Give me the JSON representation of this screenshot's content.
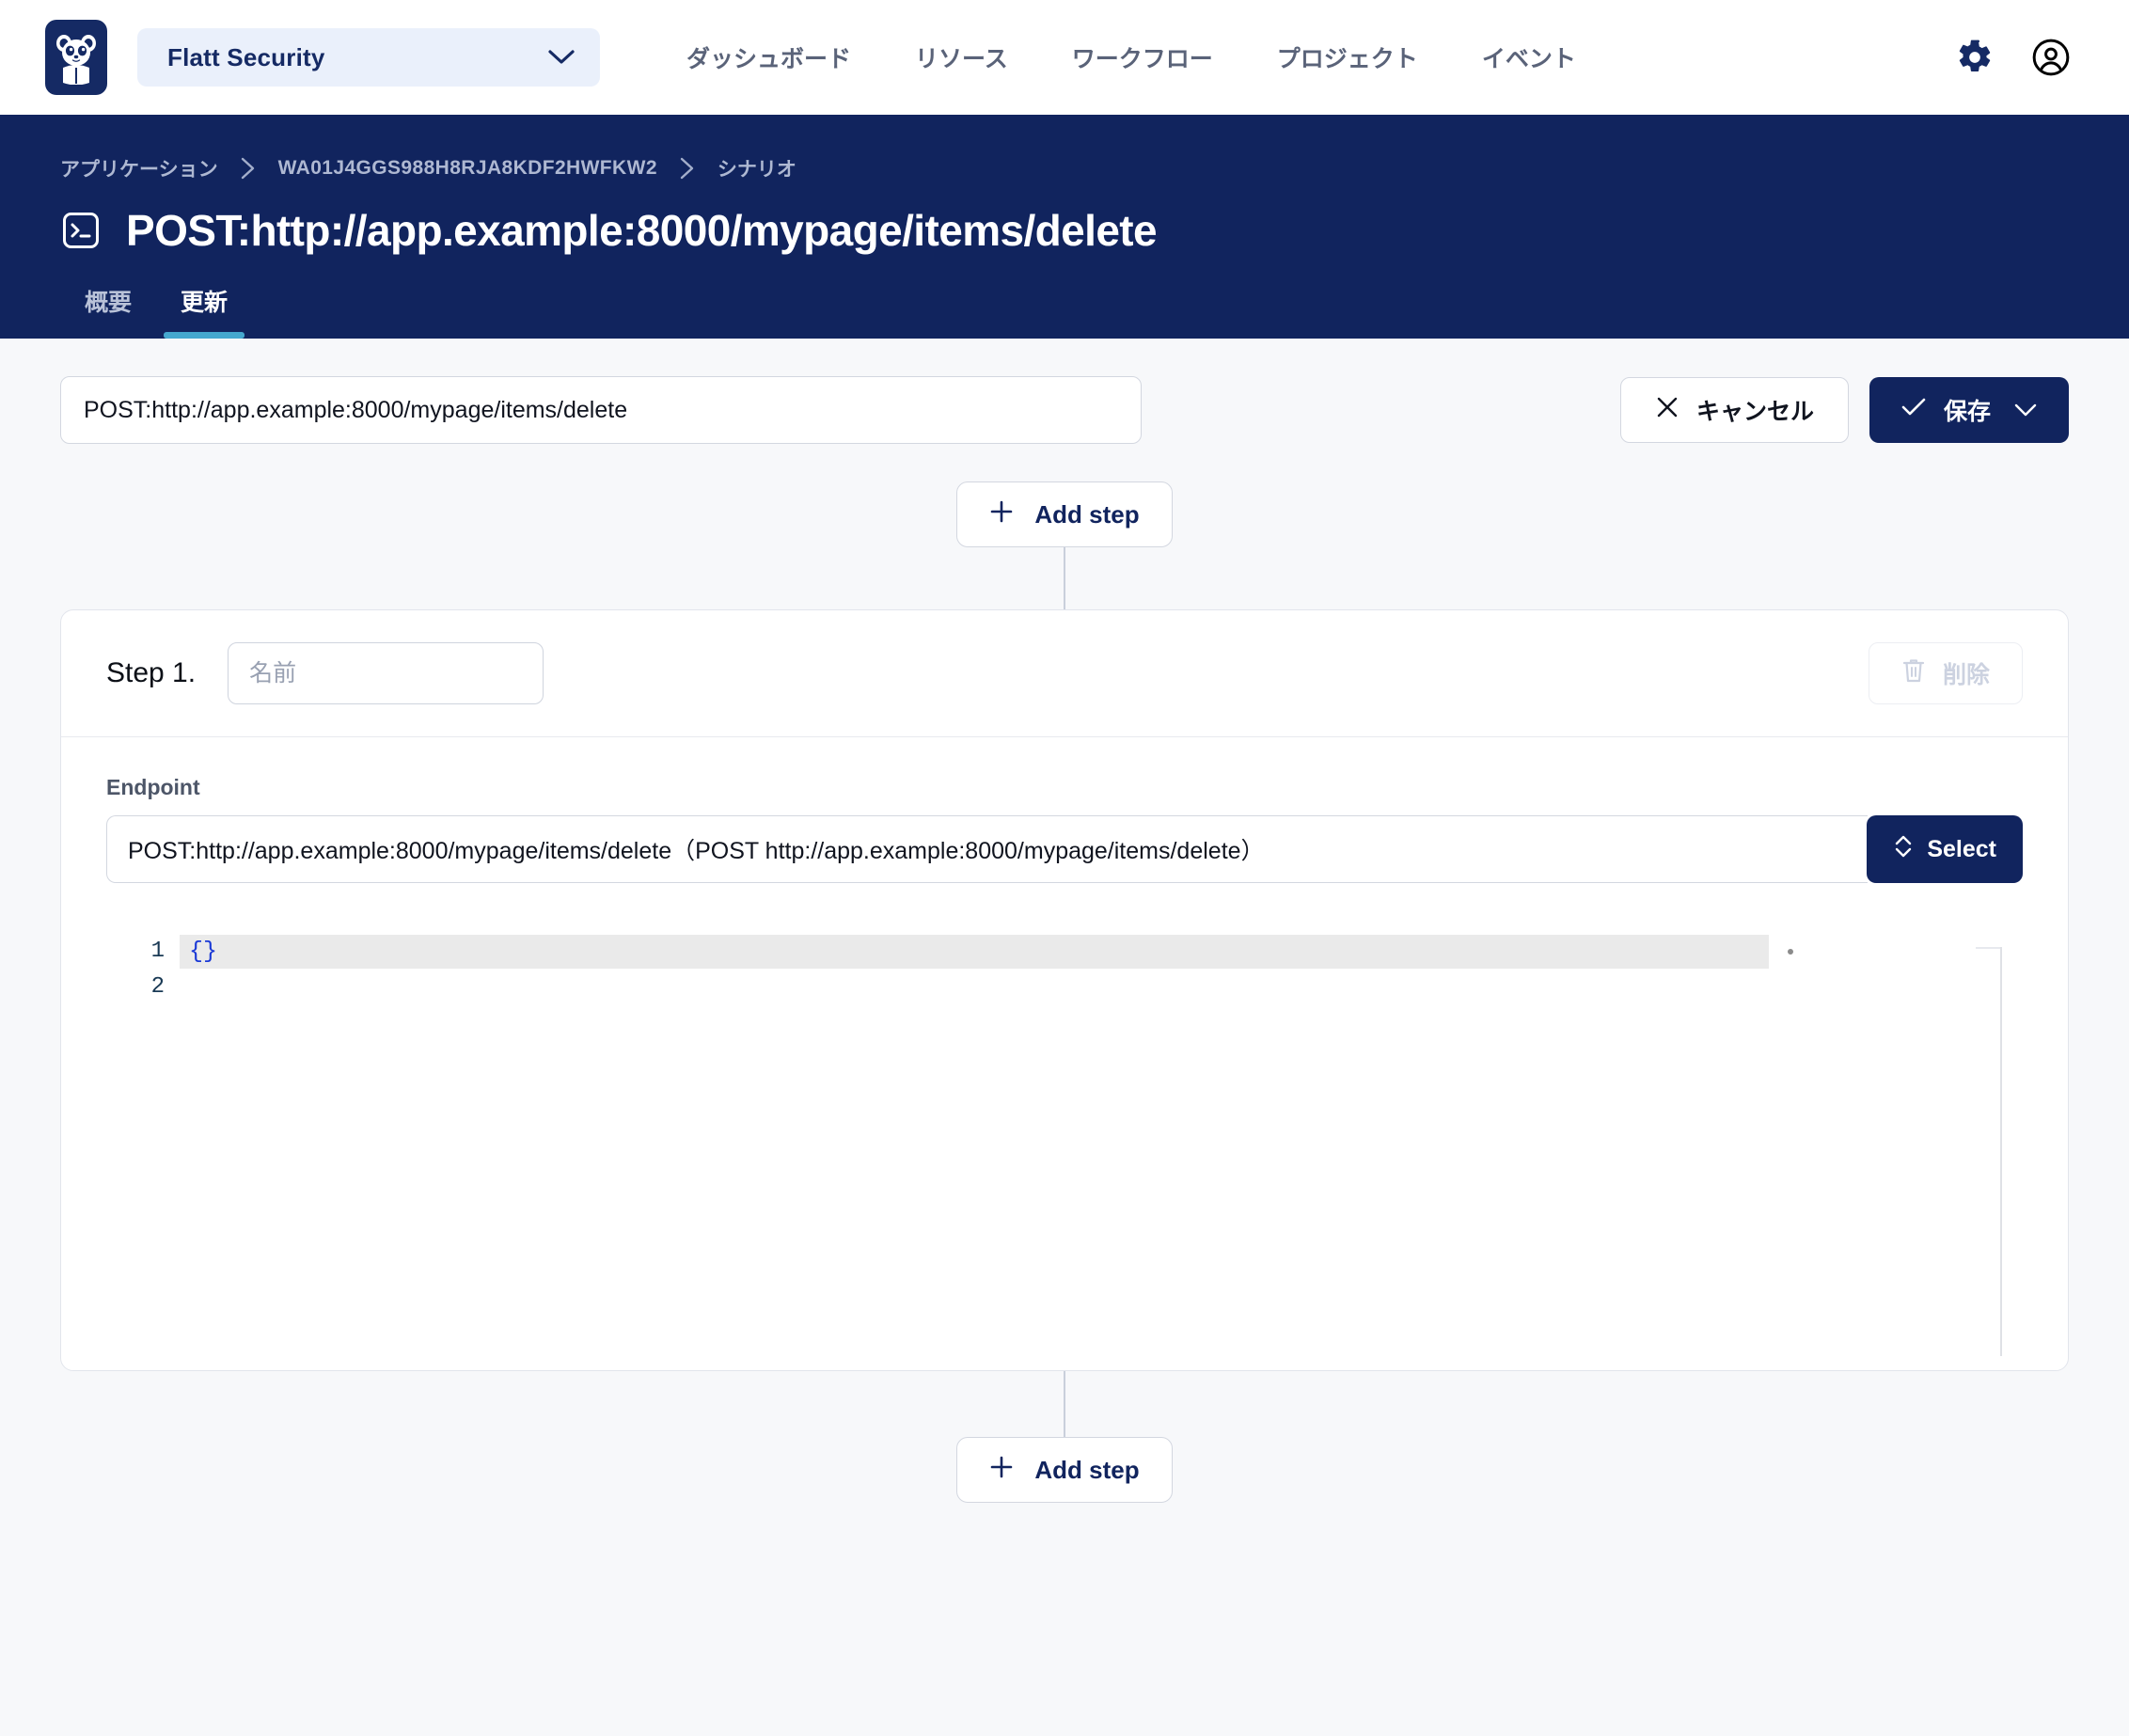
{
  "topbar": {
    "logo_icon": "panda-logo",
    "org_name": "Flatt Security",
    "org_chevron_icon": "chevron-down-icon",
    "nav": [
      {
        "label": "ダッシュボード"
      },
      {
        "label": "リソース"
      },
      {
        "label": "ワークフロー"
      },
      {
        "label": "プロジェクト"
      },
      {
        "label": "イベント"
      }
    ],
    "settings_icon": "gear-icon",
    "account_icon": "user-circle-icon"
  },
  "hero": {
    "breadcrumb": [
      {
        "label": "アプリケーション"
      },
      {
        "label": "WA01J4GGS988H8RJA8KDF2HWFKW2"
      },
      {
        "label": "シナリオ"
      }
    ],
    "breadcrumb_separator_icon": "chevron-right-icon",
    "title_icon": "terminal-icon",
    "title": "POST:http://app.example:8000/mypage/items/delete",
    "tabs": [
      {
        "label": "概要",
        "active": false
      },
      {
        "label": "更新",
        "active": true
      }
    ],
    "accent_color": "#45a8cf",
    "background_color": "#11245e"
  },
  "toolbar": {
    "scenario_name_value": "POST:http://app.example:8000/mypage/items/delete",
    "scenario_name_placeholder": "名前",
    "cancel_label": "キャンセル",
    "cancel_icon": "close-icon",
    "save_label": "保存",
    "save_icon": "check-icon",
    "save_chevron_icon": "chevron-down-icon"
  },
  "flow": {
    "add_step_top_label": "Add step",
    "add_step_bottom_label": "Add step",
    "add_step_icon": "plus-icon"
  },
  "step": {
    "number_label": "Step 1.",
    "name_value": "",
    "name_placeholder": "名前",
    "delete_label": "削除",
    "delete_icon": "trash-icon",
    "delete_disabled": true,
    "endpoint_label": "Endpoint",
    "endpoint_value": "POST:http://app.example:8000/mypage/items/delete（POST http://app.example:8000/mypage/items/delete）",
    "select_label": "Select",
    "select_icon": "chevron-up-down-icon",
    "editor": {
      "line_numbers": [
        "1",
        "2"
      ],
      "lines": [
        "{}",
        ""
      ],
      "active_line": 1
    }
  }
}
